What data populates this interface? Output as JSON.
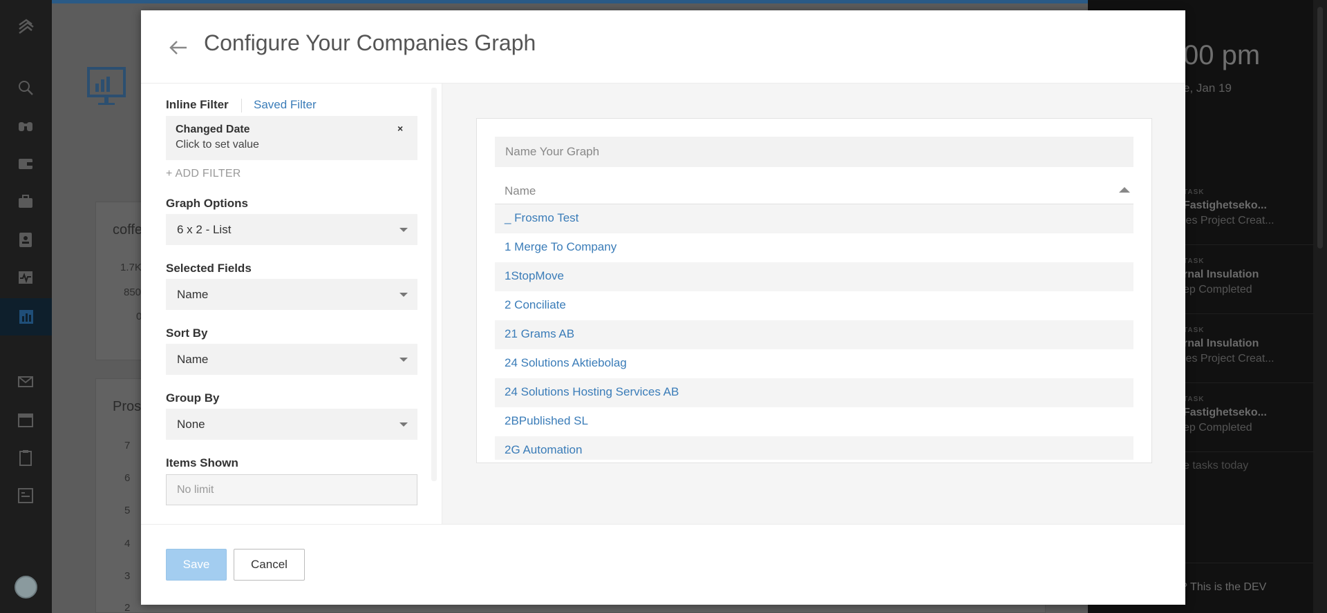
{
  "background": {
    "card1_title": "coffe",
    "card1_ticks": [
      "1.7K",
      "850",
      "0"
    ],
    "card2_title": "Pros",
    "card2_ticks": [
      "7",
      "6",
      "5",
      "4",
      "3",
      "2"
    ],
    "right_panel": {
      "time": "00 pm",
      "date": "e, Jan 19",
      "tasks": [
        {
          "kind": "TASK",
          "title": "Fastighetseko...",
          "subtitle": "les Project Creat..."
        },
        {
          "kind": "TASK",
          "title": "rnal Insulation",
          "subtitle": "ep Completed"
        },
        {
          "kind": "TASK",
          "title": "rnal Insulation",
          "subtitle": "les Project Creat..."
        },
        {
          "kind": "TASK",
          "title": "Fastighetseko...",
          "subtitle": "ep Completed"
        }
      ],
      "more_text": "e tasks today",
      "bottom_text": "? This is the DEV"
    }
  },
  "modal": {
    "title": "Configure Your Companies Graph",
    "filters": {
      "inline_tab": "Inline Filter",
      "saved_tab": "Saved Filter",
      "active_filter": {
        "name": "Changed Date",
        "value": "Click to set value",
        "close": "×"
      },
      "add_filter": "+ ADD FILTER"
    },
    "graph_options": {
      "label": "Graph Options",
      "value": "6 x 2 - List"
    },
    "selected_fields": {
      "label": "Selected Fields",
      "value": "Name"
    },
    "sort_by": {
      "label": "Sort By",
      "value": "Name"
    },
    "group_by": {
      "label": "Group By",
      "value": "None"
    },
    "items_shown": {
      "label": "Items Shown",
      "placeholder": "No limit"
    },
    "preview": {
      "name_placeholder": "Name Your Graph",
      "column_header": "Name",
      "rows": [
        "_ Frosmo Test",
        "1 Merge To Company",
        "1StopMove",
        "2 Conciliate",
        "21 Grams AB",
        "24 Solutions Aktiebolag",
        "24 Solutions Hosting Services AB",
        "2BPublished SL",
        "2G Automation"
      ]
    },
    "footer": {
      "save": "Save",
      "cancel": "Cancel"
    }
  }
}
